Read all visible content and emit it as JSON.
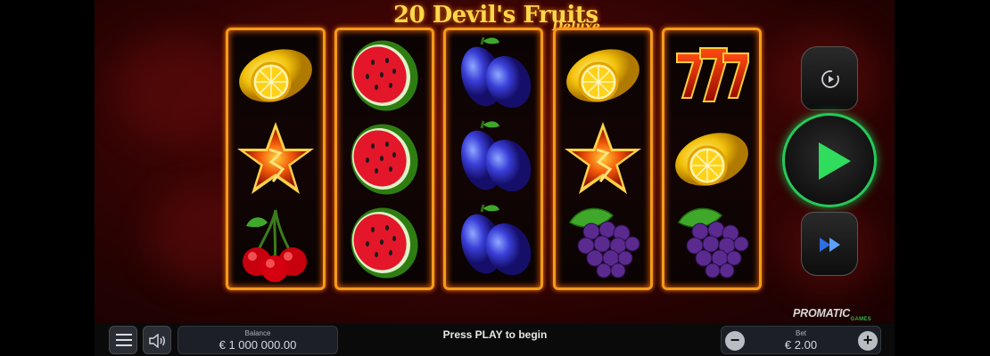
{
  "game": {
    "title": "20 Devil's Fruits",
    "subtitle": "Deluxe",
    "provider": "PROMATIC",
    "provider_sub": "GAMES"
  },
  "reels": [
    [
      "lemon",
      "star",
      "cherries"
    ],
    [
      "watermelon",
      "watermelon",
      "watermelon"
    ],
    [
      "plum",
      "plum",
      "plum"
    ],
    [
      "lemon",
      "star",
      "grapes"
    ],
    [
      "seven",
      "lemon",
      "grapes"
    ]
  ],
  "controls": {
    "autoplay_icon": "autoplay-icon",
    "spin_icon": "play-icon",
    "turbo_icon": "fast-forward-icon",
    "menu_icon": "hamburger-menu-icon",
    "sound_icon": "speaker-icon"
  },
  "footer": {
    "balance_label": "Balance",
    "balance_value": "€ 1 000 000.00",
    "message": "Press PLAY to begin",
    "bet_label": "Bet",
    "bet_value": "€ 2.00",
    "bet_minus": "−",
    "bet_plus": "+"
  },
  "colors": {
    "reel_frame": "#f39a1a",
    "play_ring": "#26c85a",
    "title_gold": "#ffd84a"
  }
}
